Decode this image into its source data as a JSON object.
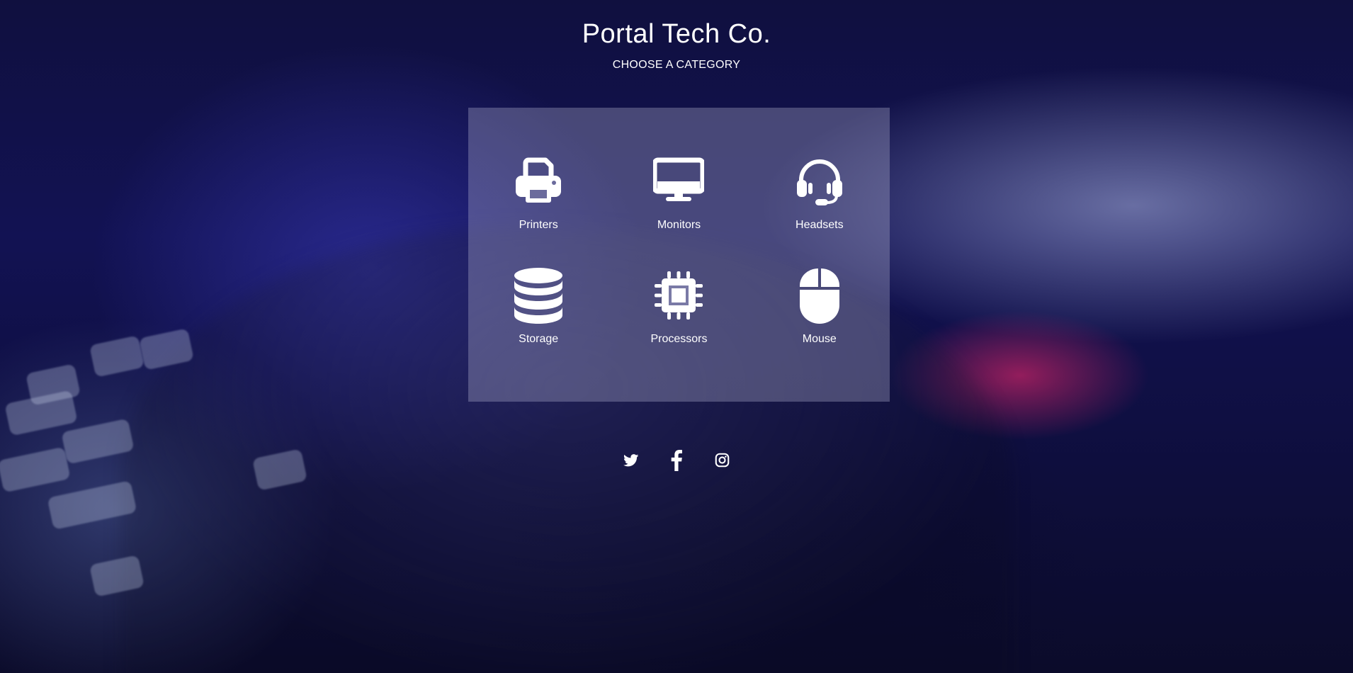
{
  "header": {
    "title": "Portal Tech Co.",
    "subtitle": "CHOOSE A CATEGORY"
  },
  "categories": [
    {
      "label": "Printers",
      "icon": "printer-icon"
    },
    {
      "label": "Monitors",
      "icon": "monitor-icon"
    },
    {
      "label": "Headsets",
      "icon": "headset-icon"
    },
    {
      "label": "Storage",
      "icon": "database-icon"
    },
    {
      "label": "Processors",
      "icon": "cpu-chip-icon"
    },
    {
      "label": "Mouse",
      "icon": "mouse-icon"
    }
  ],
  "social": [
    {
      "icon": "twitter-icon"
    },
    {
      "icon": "facebook-icon"
    },
    {
      "icon": "instagram-icon"
    }
  ],
  "colors": {
    "text": "#ffffff",
    "background_dark": "#10103f",
    "panel_overlay": "#afafcd"
  }
}
